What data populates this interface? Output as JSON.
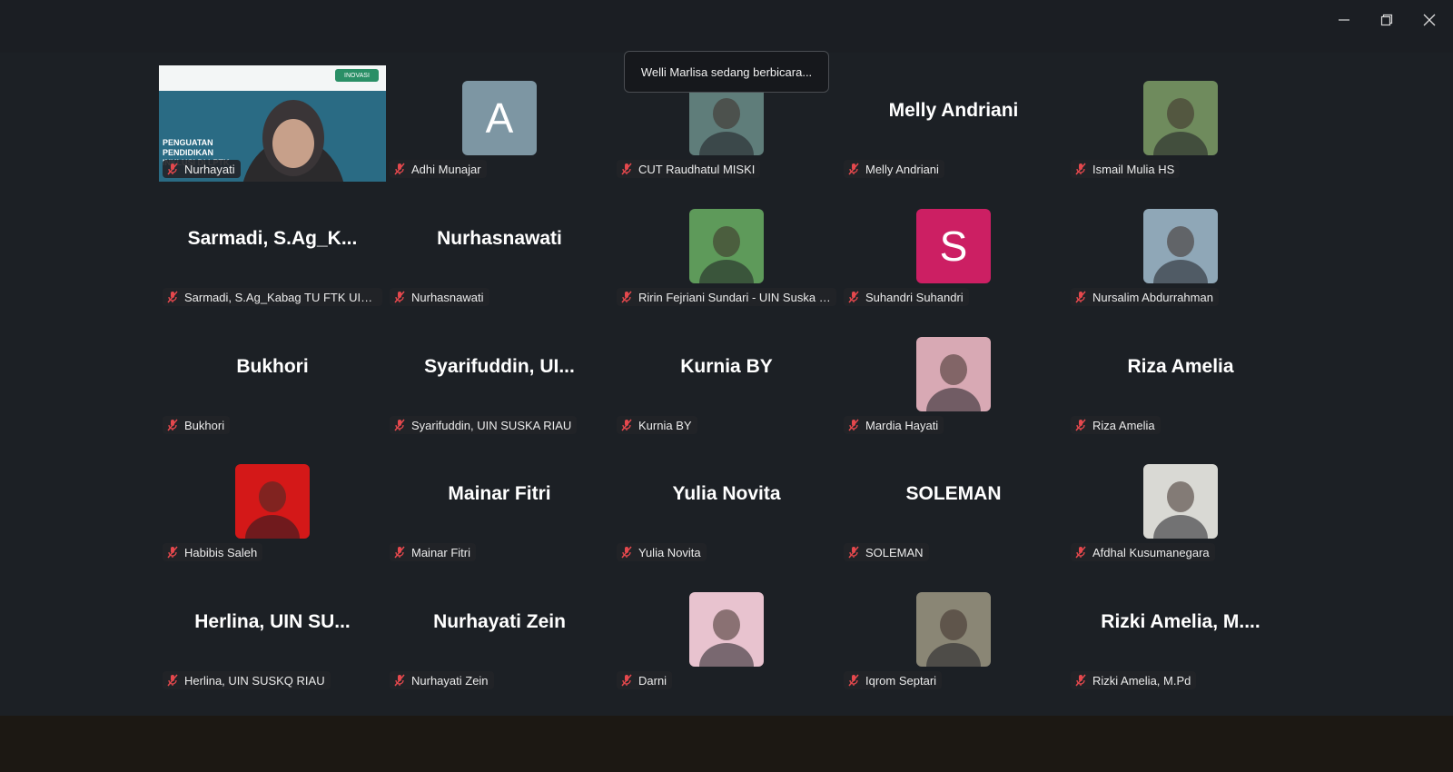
{
  "window": {
    "minimize_label": "Minimize",
    "restore_label": "Restore",
    "close_label": "Close"
  },
  "toast": "Welli Marlisa sedang berbicara...",
  "shared_slide": {
    "title": "PENGUATAN PENDIDIKAN INKLUSI DI LPTK",
    "logo": "INOVASI"
  },
  "participants": [
    {
      "name": "Nurhayati",
      "display": "",
      "kind": "video"
    },
    {
      "name": "Adhi Munajar",
      "display": "A",
      "kind": "letter",
      "color": "#7d96a3"
    },
    {
      "name": "CUT Raudhatul MISKI",
      "display": "",
      "kind": "photo",
      "color": "#5f7d7a"
    },
    {
      "name": "Melly Andriani",
      "display": "Melly Andriani",
      "kind": "text"
    },
    {
      "name": "Ismail Mulia HS",
      "display": "",
      "kind": "photo",
      "color": "#6f8b5d"
    },
    {
      "name": "Sarmadi, S.Ag_Kabag TU FTK UIN Sus...",
      "display": "Sarmadi,  S.Ag_K...",
      "kind": "text"
    },
    {
      "name": "Nurhasnawati",
      "display": "Nurhasnawati",
      "kind": "text"
    },
    {
      "name": "Ririn Fejriani Sundari - UIN Suska Riau",
      "display": "",
      "kind": "photo",
      "color": "#5e9a5a"
    },
    {
      "name": "Suhandri Suhandri",
      "display": "S",
      "kind": "letter",
      "color": "#cc1f63"
    },
    {
      "name": "Nursalim Abdurrahman",
      "display": "",
      "kind": "photo",
      "color": "#8fa7b7"
    },
    {
      "name": "Bukhori",
      "display": "Bukhori",
      "kind": "text"
    },
    {
      "name": "Syarifuddin, UIN SUSKA RIAU",
      "display": "Syarifuddin,  UI...",
      "kind": "text"
    },
    {
      "name": "Kurnia BY",
      "display": "Kurnia BY",
      "kind": "text"
    },
    {
      "name": "Mardia Hayati",
      "display": "",
      "kind": "photo",
      "color": "#d8a9b4"
    },
    {
      "name": "Riza Amelia",
      "display": "Riza Amelia",
      "kind": "text"
    },
    {
      "name": "Habibis Saleh",
      "display": "",
      "kind": "photo",
      "color": "#d41818"
    },
    {
      "name": "Mainar Fitri",
      "display": "Mainar Fitri",
      "kind": "text"
    },
    {
      "name": "Yulia Novita",
      "display": "Yulia Novita",
      "kind": "text"
    },
    {
      "name": "SOLEMAN",
      "display": "SOLEMAN",
      "kind": "text"
    },
    {
      "name": "Afdhal Kusumanegara",
      "display": "",
      "kind": "photo",
      "color": "#d9d9d4"
    },
    {
      "name": "Herlina, UIN SUSKQ RIAU",
      "display": "Herlina,  UIN  SU...",
      "kind": "text"
    },
    {
      "name": "Nurhayati Zein",
      "display": "Nurhayati Zein",
      "kind": "text"
    },
    {
      "name": "Darni",
      "display": "",
      "kind": "photo",
      "color": "#e8c3cf"
    },
    {
      "name": "Iqrom Septari",
      "display": "",
      "kind": "photo",
      "color": "#8a8675"
    },
    {
      "name": "Rizki Amelia, M.Pd",
      "display": "Rizki Amelia,  M....",
      "kind": "text"
    }
  ],
  "colors": {
    "background": "#1c2025",
    "toast_border": "#4a4d52",
    "muted_mic": "#e5484d"
  }
}
